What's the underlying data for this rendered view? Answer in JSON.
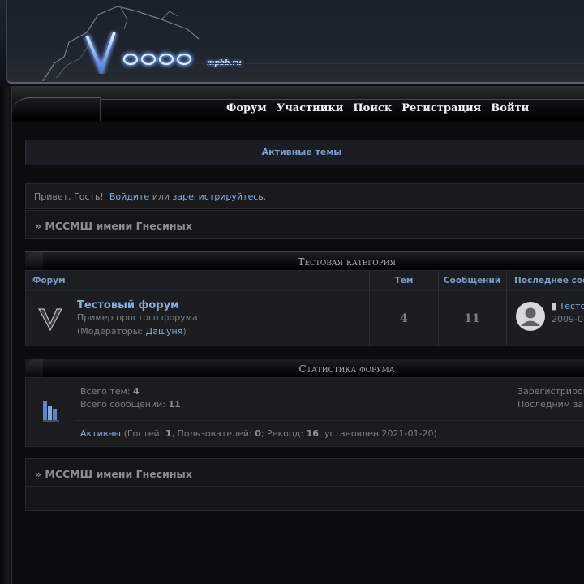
{
  "header": {
    "logo_subtitle": "mpbb.ru"
  },
  "nav": {
    "forum": "Форум",
    "members": "Участники",
    "search": "Поиск",
    "register": "Регистрация",
    "login": "Войти"
  },
  "active_topics": "Активные темы",
  "greeting": {
    "prefix": "Привет, Гость!",
    "login_link": "Войдите",
    "or": "или",
    "register_link": "зарегистрируйтесь",
    "period": "."
  },
  "breadcrumb": "» МССМШ имени Гнесиных",
  "category": {
    "title": "Тестовая категория",
    "columns": {
      "forum": "Форум",
      "topics": "Тем",
      "posts": "Сообщений",
      "last_post": "Последнее соо"
    },
    "forum": {
      "name": "Тестовый форум",
      "description": "Пример простого форума",
      "mods_prefix": "(Модераторы: ",
      "mod_name": "Дашуня",
      "mods_suffix": ")",
      "topics": "4",
      "posts": "11",
      "last_post_link": "Тесто",
      "last_post_date": "2009-0"
    }
  },
  "stats": {
    "title": "Статистика форума",
    "total_topics_label": "Всего тем: ",
    "total_topics": "4",
    "total_posts_label": "Всего сообщений: ",
    "total_posts": "11",
    "registered_label": "Зарегистриров",
    "last_registered_label": "Последним за",
    "online_link": "Активны",
    "guests_label": " (Гостей: ",
    "guests": "1",
    "users_label": ", Пользователей: ",
    "users": "0",
    "record_label": "; Рекорд: ",
    "record": "16",
    "record_suffix": ", установлен 2021-01-20)"
  }
}
